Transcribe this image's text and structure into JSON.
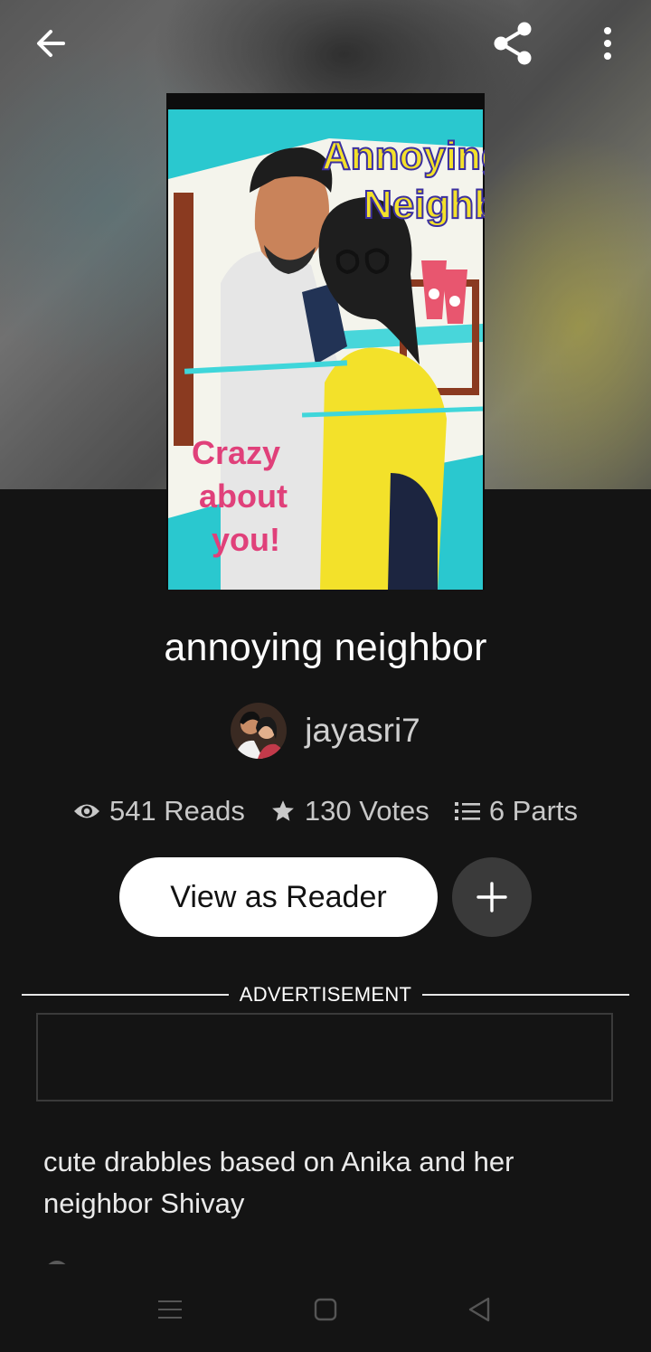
{
  "book": {
    "title": "annoying neighbor",
    "author": "jayasri7",
    "cover": {
      "title_line1": "Annoying",
      "title_line2": "Neighbo",
      "tagline": [
        "Crazy",
        "about",
        "you!"
      ]
    },
    "description": "cute drabbles based on Anika and her neighbor Shivay"
  },
  "stats": {
    "reads": "541 Reads",
    "votes": "130 Votes",
    "parts": "6 Parts"
  },
  "actions": {
    "view_as_reader": "View as Reader"
  },
  "ad": {
    "label": "ADVERTISEMENT"
  },
  "icons": {
    "back": "arrow-left-icon",
    "share": "share-icon",
    "more": "more-vertical-icon",
    "reads": "eye-icon",
    "votes": "star-icon",
    "parts": "list-icon",
    "add": "plus-icon"
  },
  "colors": {
    "background": "#141414",
    "button_bg": "#ffffff",
    "add_button_bg": "#3a3a3a",
    "cover_accent_cyan": "#2ac8cf",
    "cover_accent_yellow": "#f3e12a",
    "cover_tagline_pink": "#e0407a"
  }
}
